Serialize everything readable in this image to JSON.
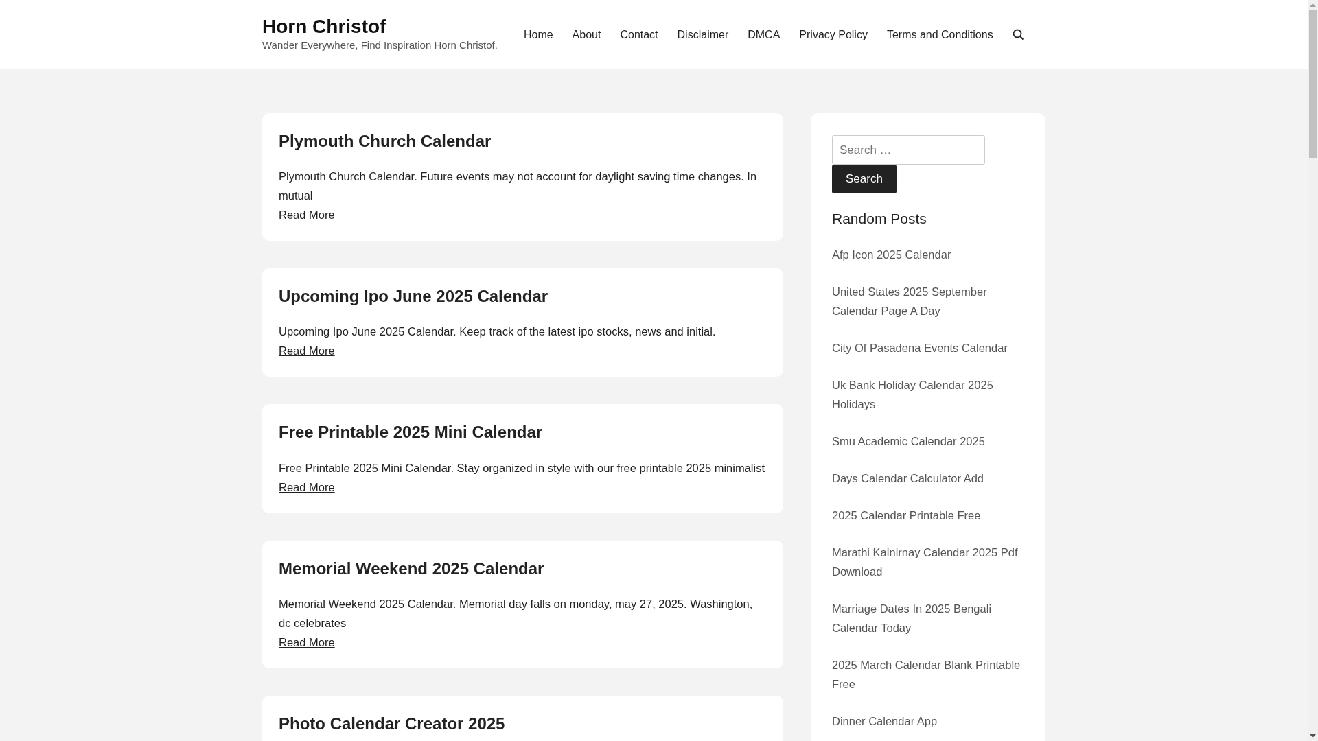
{
  "site": {
    "title": "Horn Christof",
    "tagline": "Wander Everywhere, Find Inspiration Horn Christof."
  },
  "nav": [
    "Home",
    "About",
    "Contact",
    "Disclaimer",
    "DMCA",
    "Privacy Policy",
    "Terms and Conditions"
  ],
  "posts": [
    {
      "title": "Plymouth Church Calendar",
      "excerpt": "Plymouth Church Calendar. Future events may not account for daylight saving time changes. In mutual",
      "link": "Read More"
    },
    {
      "title": "Upcoming Ipo June 2025 Calendar",
      "excerpt": "Upcoming Ipo June 2025 Calendar. Keep track of the latest ipo stocks, news and initial.",
      "link": "Read More"
    },
    {
      "title": "Free Printable 2025 Mini Calendar",
      "excerpt": "Free Printable 2025 Mini Calendar. Stay organized in style with our free printable 2025 minimalist",
      "link": "Read More"
    },
    {
      "title": "Memorial Weekend 2025 Calendar",
      "excerpt": "Memorial Weekend 2025 Calendar. Memorial day falls on monday, may 27, 2025. Washington, dc celebrates",
      "link": "Read More"
    },
    {
      "title": "Photo Calendar Creator 2025"
    }
  ],
  "sidebar": {
    "search": {
      "placeholder": "Search …",
      "button": "Search"
    },
    "heading": "Random Posts",
    "random_posts": [
      "Afp Icon 2025 Calendar",
      "United States 2025 September Calendar Page A Day",
      "City Of Pasadena Events Calendar",
      "Uk Bank Holiday Calendar 2025 Holidays",
      "Smu Academic Calendar 2025",
      "Days Calendar Calculator Add",
      "2025 Calendar Printable Free",
      "Marathi Kalnirnay Calendar 2025 Pdf Download",
      "Marriage Dates In 2025 Bengali Calendar Today",
      "2025 March Calendar Blank Printable Free",
      "Dinner Calendar App"
    ]
  }
}
